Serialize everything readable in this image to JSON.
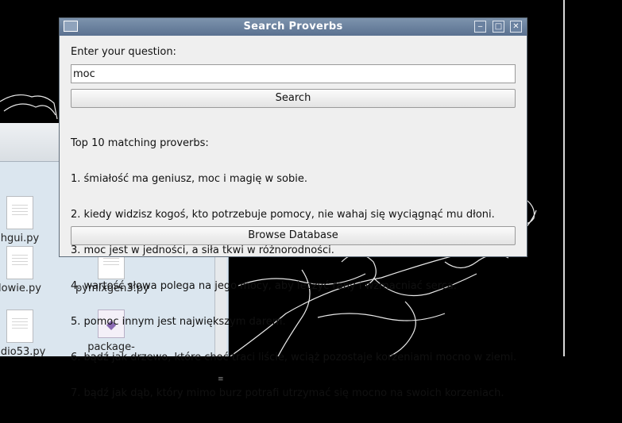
{
  "dialog": {
    "title": "Search Proverbs",
    "question_label": "Enter your question:",
    "query_value": "moc",
    "search_button": "Search",
    "results_header": "Top 10 matching proverbs:",
    "results": [
      "1. śmiałość ma geniusz, moc i magię w sobie.",
      "2. kiedy widzisz kogoś, kto potrzebuje pomocy, nie wahaj się wyciągnąć mu dłoni.",
      "3. moc jest w jedności, a siła tkwi w różnorodności.",
      "4. wartość słowa polega na jego mocy, aby leczyć rany i wzmacniać serca.",
      "5. pomoc innym jest największym darem.",
      "6. bądź jak drzewo, które choć traci liście, wciąż pozostaje korzeniami mocno w ziemi.",
      "7. bądź jak dąb, który mimo burz potrafi utrzymać się mocno na swoich korzeniach."
    ],
    "browse_button": "Browse Database",
    "window_buttons": {
      "minimize": "‒",
      "maximize": "□",
      "close": "✕"
    }
  },
  "file_manager": {
    "items": [
      {
        "label": "hgui.py",
        "icon": "document-icon"
      },
      {
        "label": "lowie.py",
        "icon": "document-icon"
      },
      {
        "label": "pymixgen3.py",
        "icon": "document-icon"
      },
      {
        "label": "udio53.py",
        "icon": "document-icon"
      },
      {
        "label": "package-",
        "icon": "package-icon"
      }
    ]
  },
  "colors": {
    "titlebar": "#5a7190",
    "dialog_bg": "#efefef",
    "desktop_bg": "#000000",
    "file_manager_bg": "#dbe6ef"
  }
}
